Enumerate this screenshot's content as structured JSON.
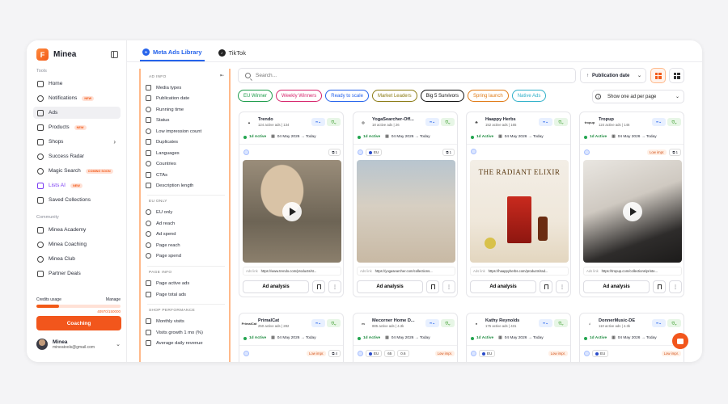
{
  "app": {
    "name": "Minea",
    "logo_letter": "F"
  },
  "sidebar": {
    "tools_label": "Tools",
    "community_label": "Community",
    "items": [
      {
        "label": "Home"
      },
      {
        "label": "Notifications",
        "badge": "NEW"
      },
      {
        "label": "Ads"
      },
      {
        "label": "Products",
        "badge": "NEW"
      },
      {
        "label": "Shops"
      },
      {
        "label": "Success Radar"
      },
      {
        "label": "Magic Search",
        "badge": "COMING SOON"
      },
      {
        "label": "Lists AI",
        "badge": "NEW"
      },
      {
        "label": "Saved Collections"
      }
    ],
    "community": [
      {
        "label": "Minea Academy"
      },
      {
        "label": "Minea Coaching"
      },
      {
        "label": "Minea Club"
      },
      {
        "label": "Partner Deals"
      }
    ],
    "credits": {
      "label": "Credits usage",
      "manage": "Manage",
      "count": "40970/150000",
      "used_fraction": 0.27
    },
    "coaching_button": "Coaching",
    "user": {
      "name": "Minea",
      "email": "mineatools@gmail.com"
    }
  },
  "tabs": [
    {
      "label": "Meta Ads Library",
      "active": true
    },
    {
      "label": "TikTok",
      "active": false
    }
  ],
  "filters": {
    "sections": [
      {
        "title": "AD INFO",
        "items": [
          "Media types",
          "Publication date",
          "Running time",
          "Status",
          "Low impression count",
          "Duplicates",
          "Languages",
          "Countries",
          "CTAs",
          "Description length"
        ]
      },
      {
        "title": "EU ONLY",
        "items": [
          "EU only",
          "Ad reach",
          "Ad spend",
          "Page reach",
          "Page spend"
        ]
      },
      {
        "title": "PAGE INFO",
        "items": [
          "Page active ads",
          "Page total ads"
        ]
      },
      {
        "title": "SHOP PERFORMANCE",
        "items": [
          "Monthly visits",
          "Visits growth 1 mo (%)",
          "Average daily revenue"
        ]
      }
    ]
  },
  "search": {
    "placeholder": "Search..."
  },
  "sort": {
    "label": "Publication date"
  },
  "chips": [
    {
      "label": "EU Winner",
      "color": "#1c9c4a"
    },
    {
      "label": "Weekly Winners",
      "color": "#d6246b"
    },
    {
      "label": "Ready to scale",
      "color": "#2563eb"
    },
    {
      "label": "Market Leaders",
      "color": "#8a7a12"
    },
    {
      "label": "Big 5 Survivors",
      "color": "#111111"
    },
    {
      "label": "Spring launch",
      "color": "#e07a15"
    },
    {
      "label": "Native Ads",
      "color": "#2fb0c9"
    }
  ],
  "show_one": {
    "label": "Show one ad per page"
  },
  "cards": [
    {
      "name": "Trendo",
      "sub": "124 active ads | 134",
      "active": "1d Active",
      "date": "04 May 2026 → Today",
      "eu": "",
      "low": "",
      "dup": "1",
      "link_label": "Ads link",
      "link": "https://www.trendo.com/products/st...",
      "analysis": "Ad analysis",
      "has_play": true,
      "logo": "▲"
    },
    {
      "name": "YogaSearcher-Off...",
      "sub": "18 active ads | 26",
      "active": "1d Active",
      "date": "04 May 2026 → Today",
      "eu": "EU",
      "low": "",
      "dup": "1",
      "link_label": "Ads link",
      "link": "https://yogasearcher.com/collections...",
      "analysis": "Ad analysis",
      "has_play": false,
      "logo": "◎"
    },
    {
      "name": "Haappy Herbs",
      "sub": "152 active ads | 165",
      "active": "1d Active",
      "date": "04 May 2026 → Today",
      "eu": "",
      "low": "",
      "dup": "",
      "link_label": "Ads link",
      "link": "https://haappyherbs.com/products/rad...",
      "analysis": "Ad analysis",
      "has_play": false,
      "logo": "☘",
      "poster_title": "THE RADIANT ELIXIR"
    },
    {
      "name": "Tropup",
      "sub": "124 active ads | 146",
      "active": "1d Active",
      "date": "04 May 2026 → Today",
      "eu": "",
      "low": "Low impr.",
      "dup": "1",
      "link_label": "Ads link",
      "link": "https://tropup.com/collections/printe...",
      "analysis": "Ad analysis",
      "has_play": true,
      "logo": "tropup"
    },
    {
      "name": "PrimalCat",
      "sub": "250 active ads | 282",
      "active": "1d Active",
      "date": "04 May 2026 → Today",
      "eu": "",
      "low": "Low impr.",
      "dup": "4",
      "logo": "PrimalCat"
    },
    {
      "name": "Mecorner Home D...",
      "sub": "885 active ads | 4.3k",
      "active": "1d Active",
      "date": "04 May 2026 → Today",
      "eu": "EU",
      "eu_a": "65",
      "eu_b": "0.6",
      "low": "Low impr.",
      "dup": "",
      "logo": "m"
    },
    {
      "name": "Kathy Reynolds",
      "sub": "175 active ads | 431",
      "active": "1d Active",
      "date": "04 May 2026 → Today",
      "eu": "EU",
      "low": "Low impr.",
      "dup": "",
      "logo": "●"
    },
    {
      "name": "DonnerMusic-DE",
      "sub": "110 active ads | 4.3k",
      "active": "1d Active",
      "date": "04 May 2026 → Today",
      "eu": "EU",
      "low": "Low impr.",
      "dup": "",
      "logo": "♫"
    }
  ],
  "colors": {
    "accent": "#f2561c",
    "primary_blue": "#2563eb"
  }
}
